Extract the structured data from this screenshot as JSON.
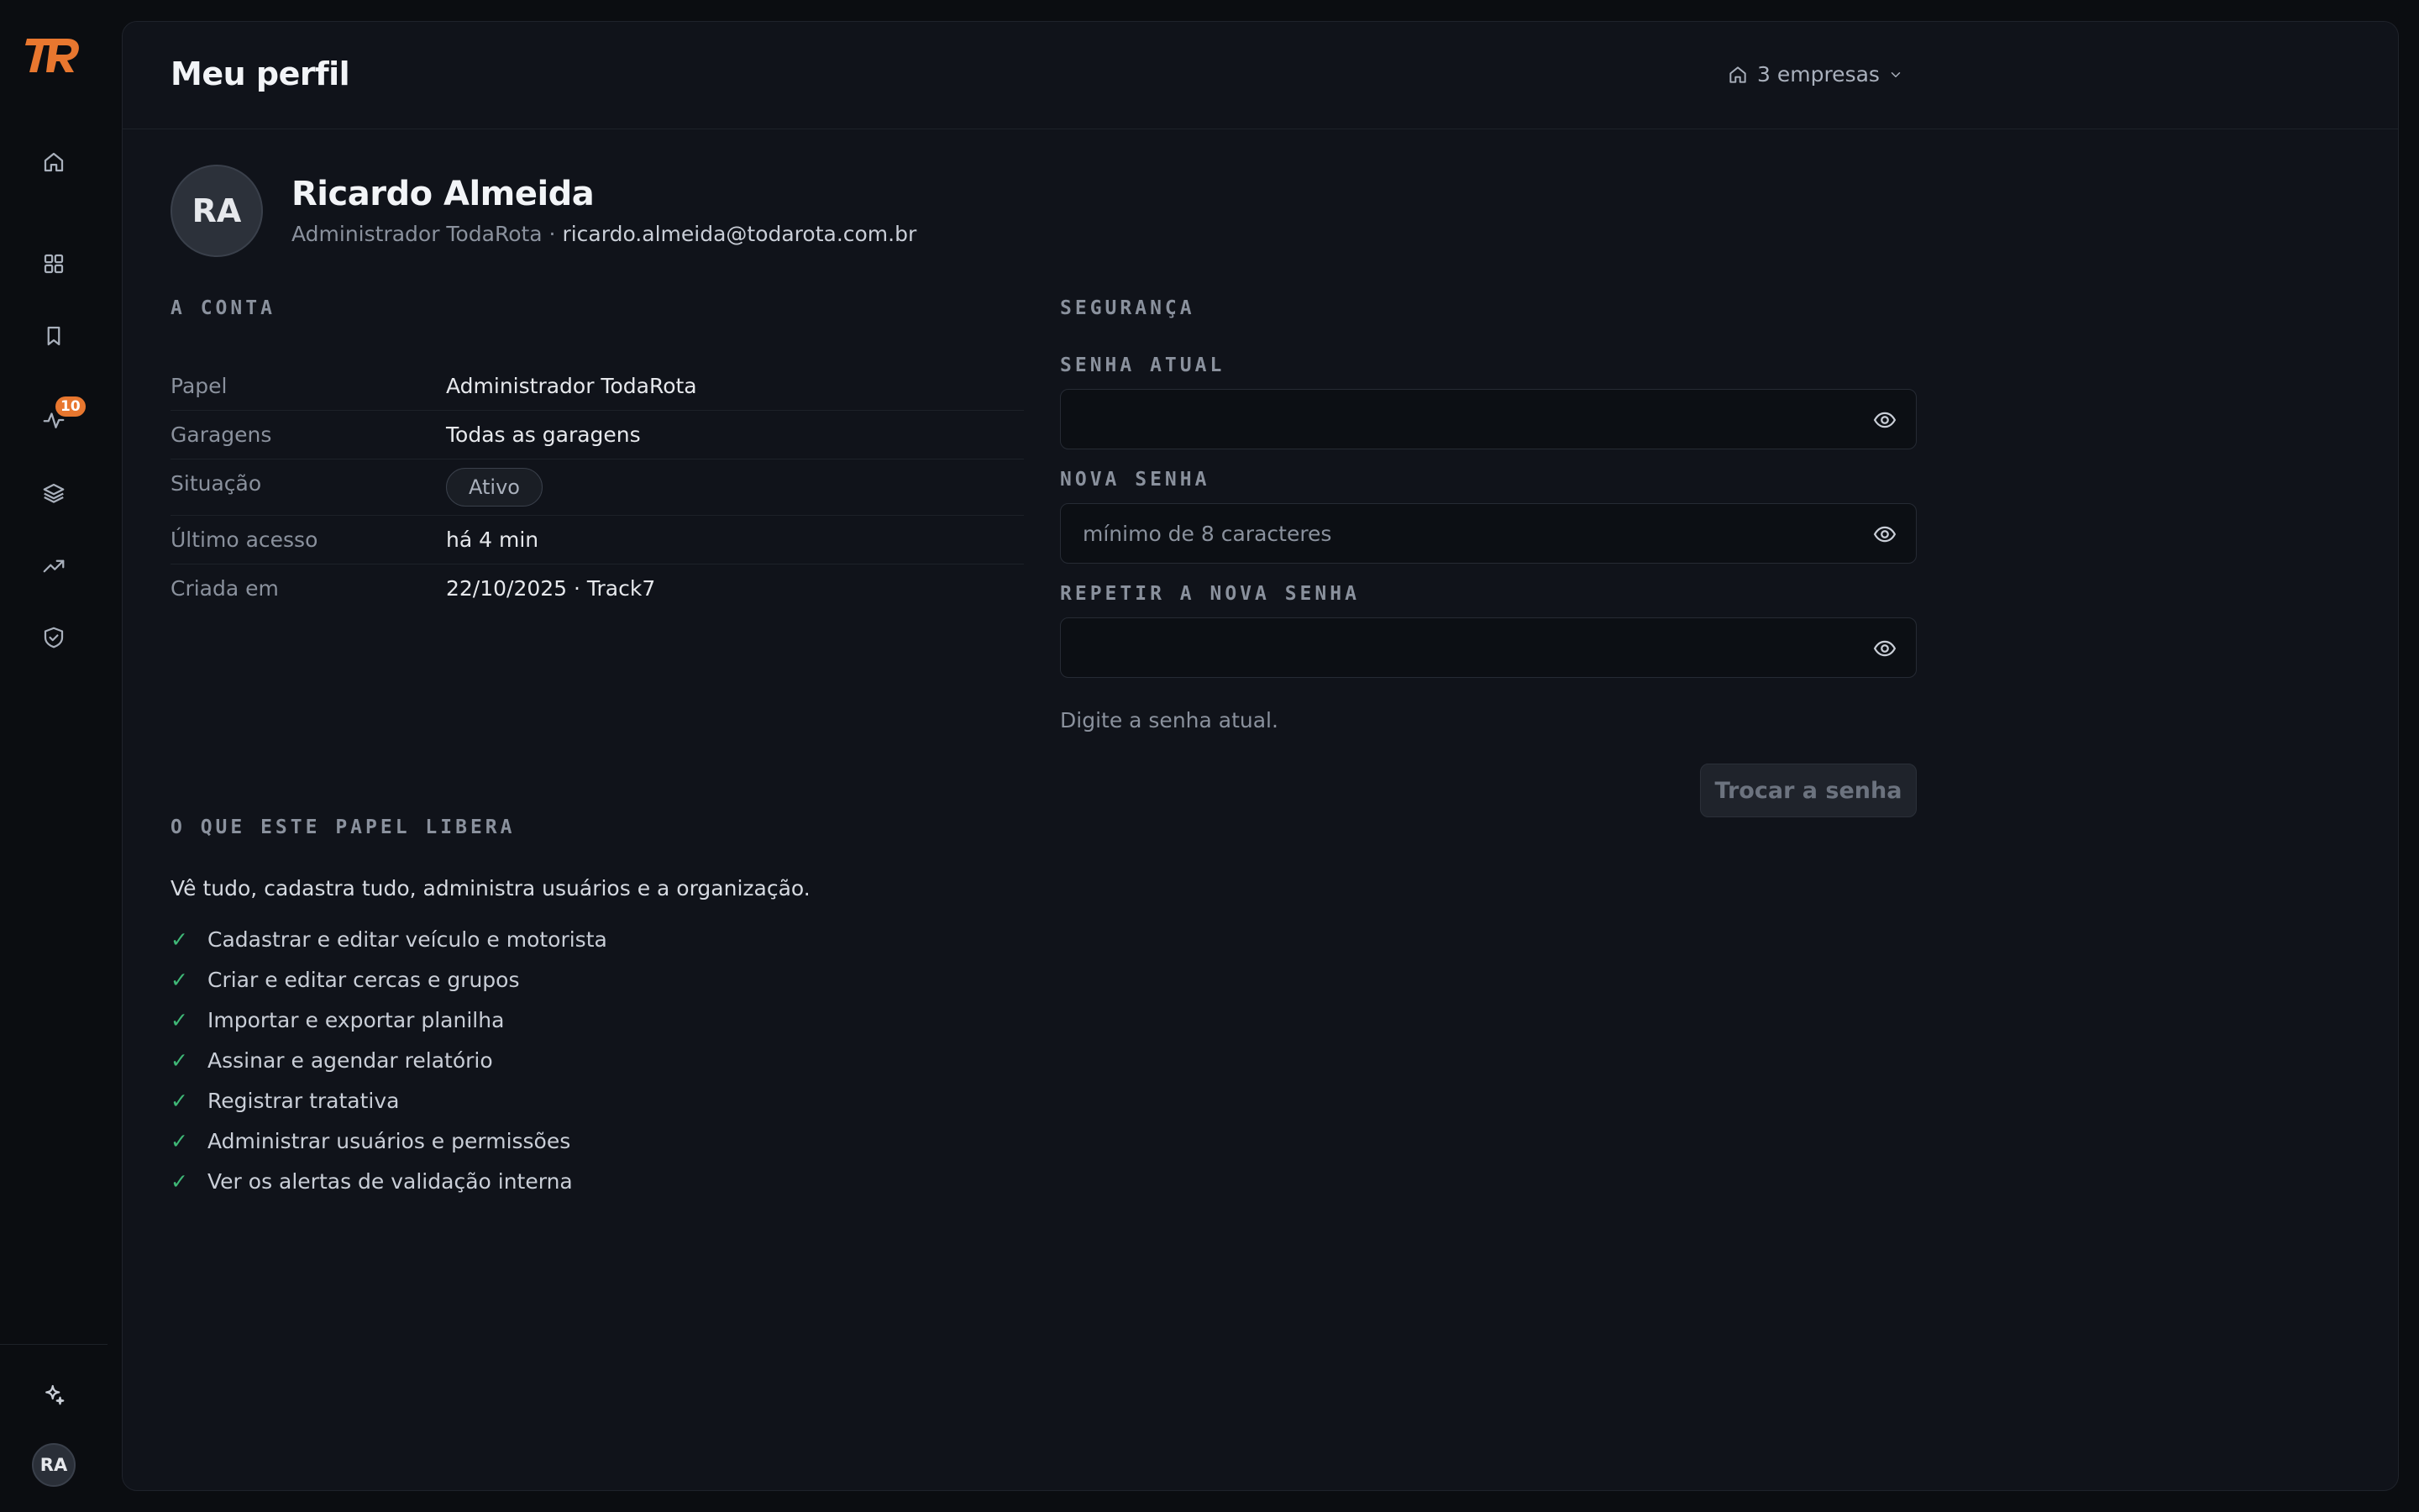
{
  "sidebar": {
    "logo": "TR",
    "logo_color": "#e8772f",
    "items": [
      {
        "icon": "home-icon"
      },
      {
        "icon": "grid-icon"
      },
      {
        "icon": "bookmark-icon"
      },
      {
        "icon": "activity-icon",
        "badge": "10"
      },
      {
        "icon": "layers-icon"
      },
      {
        "icon": "trending-up-icon"
      },
      {
        "icon": "shield-check-icon"
      }
    ],
    "sparkle_icon": "sparkle-icon",
    "user_initials": "RA"
  },
  "header": {
    "title": "Meu perfil",
    "company_switch": "3 empresas"
  },
  "profile": {
    "initials": "RA",
    "name": "Ricardo Almeida",
    "role": "Administrador TodaRota",
    "separator": " · ",
    "email": "ricardo.almeida@todarota.com.br"
  },
  "account": {
    "section_title": "A CONTA",
    "rows": [
      {
        "label": "Papel",
        "value": "Administrador TodaRota"
      },
      {
        "label": "Garagens",
        "value": "Todas as garagens"
      },
      {
        "label": "Situação",
        "value": "Ativo"
      },
      {
        "label": "Último acesso",
        "value": "há 4 min"
      },
      {
        "label": "Criada em",
        "value": "22/10/2025 · Track7"
      }
    ]
  },
  "security": {
    "section_title": "SEGURANÇA",
    "current_label": "SENHA ATUAL",
    "current_value": "",
    "current_placeholder": "",
    "new_label": "NOVA SENHA",
    "new_value": "",
    "new_placeholder": "mínimo de 8 caracteres",
    "repeat_label": "REPETIR A NOVA SENHA",
    "repeat_value": "",
    "repeat_placeholder": "",
    "hint": "Digite a senha atual.",
    "submit_label": "Trocar a senha"
  },
  "role": {
    "section_title": "O QUE ESTE PAPEL LIBERA",
    "description": "Vê tudo, cadastra tudo, administra usuários e a organização.",
    "check_mark": "✓",
    "permissions": [
      "Cadastrar e editar veículo e motorista",
      "Criar e editar cercas e grupos",
      "Importar e exportar planilha",
      "Assinar e agendar relatório",
      "Registrar tratativa",
      "Administrar usuários e permissões",
      "Ver os alertas de validação interna"
    ]
  }
}
